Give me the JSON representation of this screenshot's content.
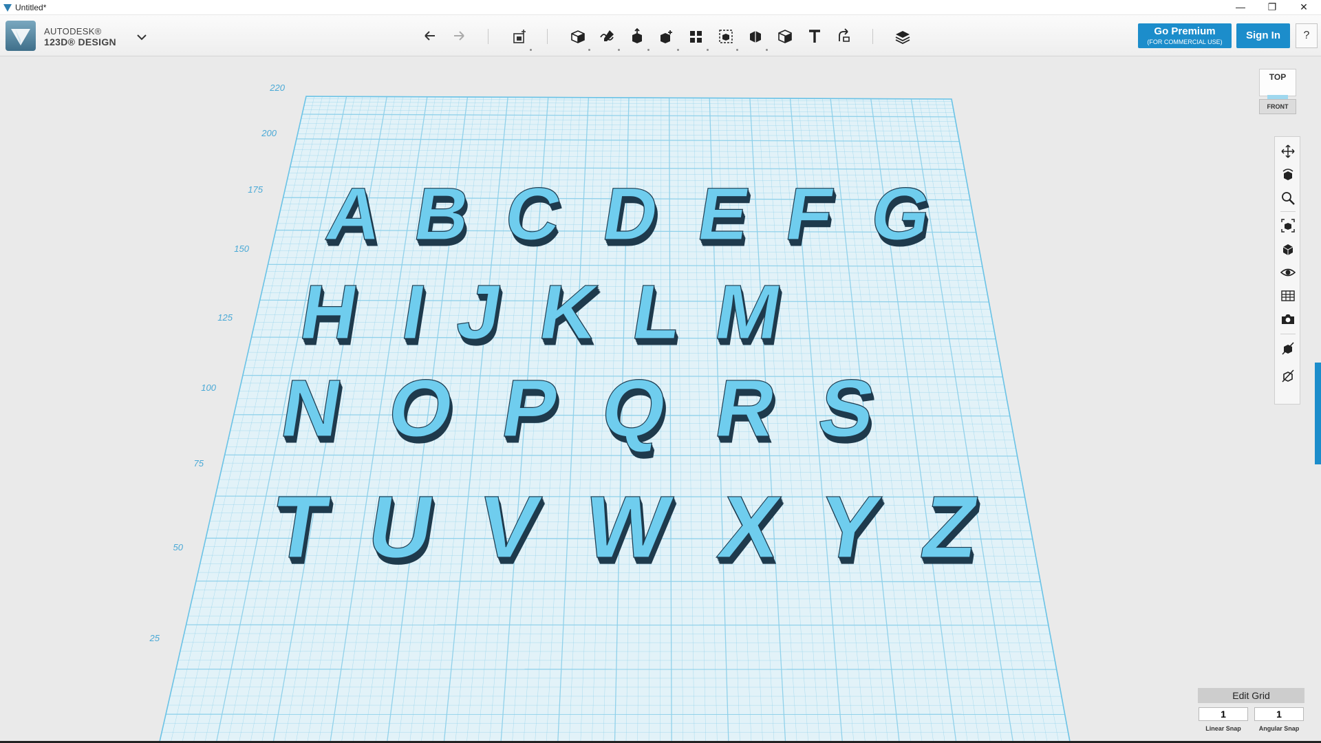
{
  "window": {
    "title": "Untitled*"
  },
  "app": {
    "brand_line1": "AUTODESK®",
    "brand_line2": "123D® DESIGN"
  },
  "toolbar": {
    "premium_label": "Go Premium",
    "premium_sub": "(FOR COMMERCIAL USE)",
    "signin_label": "Sign In",
    "help_label": "?",
    "tools": [
      "undo-icon",
      "redo-icon",
      "transform-icon",
      "primitives-icon",
      "sketch-icon",
      "construct-icon",
      "modify-icon",
      "pattern-icon",
      "grouping-icon",
      "combine-icon",
      "measure-icon",
      "text-icon",
      "snap-icon",
      "material-icon"
    ]
  },
  "viewcube": {
    "top": "TOP",
    "front": "FRONT"
  },
  "grid": {
    "labels": [
      "220",
      "200",
      "175",
      "150",
      "125",
      "100",
      "75",
      "50",
      "25"
    ],
    "rows": [
      [
        "A",
        "B",
        "C",
        "D",
        "E",
        "F",
        "G"
      ],
      [
        "H",
        "I",
        "J",
        "K",
        "L",
        "M"
      ],
      [
        "N",
        "O",
        "P",
        "Q",
        "R",
        "S"
      ],
      [
        "T",
        "U",
        "V",
        "W",
        "X",
        "Y",
        "Z"
      ]
    ]
  },
  "edit_grid": {
    "button_label": "Edit Grid",
    "linear_value": "1",
    "angular_value": "1",
    "linear_label": "Linear Snap",
    "angular_label": "Angular Snap"
  },
  "colors": {
    "accent": "#1c8dcb",
    "letter_face": "#6fcdee",
    "letter_side": "#1f3a4c",
    "grid_line": "#8dd0ea"
  }
}
